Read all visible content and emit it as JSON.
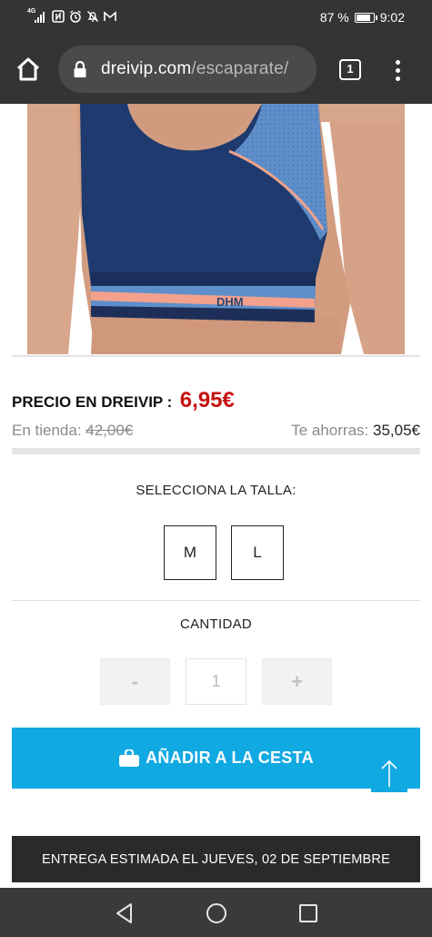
{
  "status_bar": {
    "network": "4G",
    "battery": "87 %",
    "battery_level": 0.87,
    "time": "9:02"
  },
  "browser": {
    "url_domain": "dreivip.com",
    "url_path": "/escaparate/",
    "tab_count": "1"
  },
  "product": {
    "price_label": "PRECIO EN DREIVIP :",
    "price": "6,95€",
    "store_label": "En tienda:",
    "store_price": "42,00€",
    "savings_label": "Te ahorras:",
    "savings": "35,05€",
    "image_logo": "DHM"
  },
  "size": {
    "title": "SELECCIONA LA TALLA:",
    "options": [
      "M",
      "L"
    ]
  },
  "quantity": {
    "title": "CANTIDAD",
    "minus": "-",
    "value": "1",
    "plus": "+"
  },
  "cart": {
    "button_label": "AÑADIR A LA CESTA"
  },
  "delivery": {
    "text": "ENTREGA ESTIMADA EL JUEVES, 02 DE SEPTIEMBRE"
  },
  "colors": {
    "accent": "#10a9e2",
    "price": "#c61212",
    "dark_bar": "#2a2a2a"
  }
}
